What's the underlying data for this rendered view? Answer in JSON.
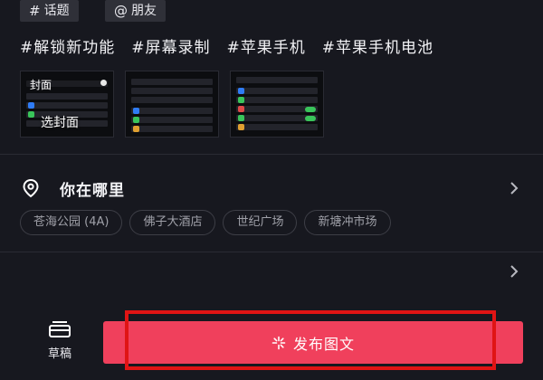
{
  "top_buttons": {
    "topic": {
      "symbol": "#",
      "label": "话题"
    },
    "friend": {
      "symbol": "@",
      "label": "朋友"
    }
  },
  "hashtags": [
    "#解锁新功能",
    "#屏幕录制",
    "#苹果手机",
    "#苹果手机电池"
  ],
  "thumbnails": {
    "cover_label": "封面",
    "pick_cover_label": "选封面"
  },
  "location": {
    "title": "你在哪里",
    "icon": "location-pin-icon",
    "places": [
      "苍海公园 (4A)",
      "佛子大酒店",
      "世纪广场",
      "新塘冲市场"
    ]
  },
  "bottom": {
    "draft_label": "草稿",
    "publish_label": "发布图文",
    "publish_icon": "sparkle-icon"
  },
  "colors": {
    "background": "#17181f",
    "publish_button": "#f0405c",
    "highlight_box": "#e01414"
  }
}
